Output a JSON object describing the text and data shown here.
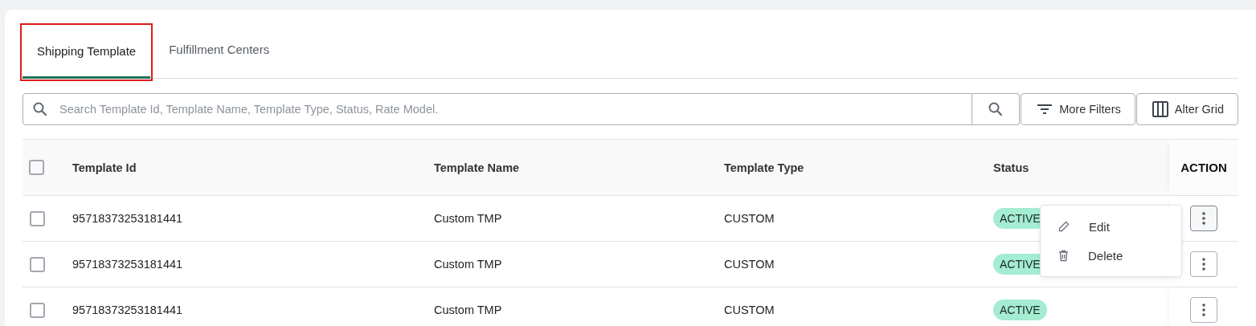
{
  "tabs": [
    {
      "label": "Shipping Template",
      "selected": true,
      "highlighted": true
    },
    {
      "label": "Fulfillment Centers",
      "selected": false,
      "highlighted": false
    }
  ],
  "search": {
    "placeholder": "Search Template Id, Template Name, Template Type, Status, Rate Model."
  },
  "toolbar_buttons": [
    {
      "kind": "filter",
      "label": "More Filters"
    },
    {
      "kind": "columns",
      "label": "Alter Grid"
    }
  ],
  "table": {
    "columns": [
      "Template Id",
      "Template Name",
      "Template Type",
      "Status",
      "ACTION"
    ],
    "select_all_checked": false,
    "rows": [
      {
        "selected": false,
        "menu_open": true,
        "template_id": "95718373253181441",
        "template_name": "Custom TMP",
        "template_type": "CUSTOM",
        "status": "ACTIVE"
      },
      {
        "selected": false,
        "menu_open": false,
        "template_id": "95718373253181441",
        "template_name": "Custom TMP",
        "template_type": "CUSTOM",
        "status": "ACTIVE"
      },
      {
        "selected": false,
        "menu_open": false,
        "template_id": "95718373253181441",
        "template_name": "Custom TMP",
        "template_type": "CUSTOM",
        "status": "ACTIVE"
      }
    ]
  },
  "action_menu": {
    "items": [
      {
        "kind": "edit",
        "label": "Edit"
      },
      {
        "kind": "delete",
        "label": "Delete"
      }
    ]
  }
}
